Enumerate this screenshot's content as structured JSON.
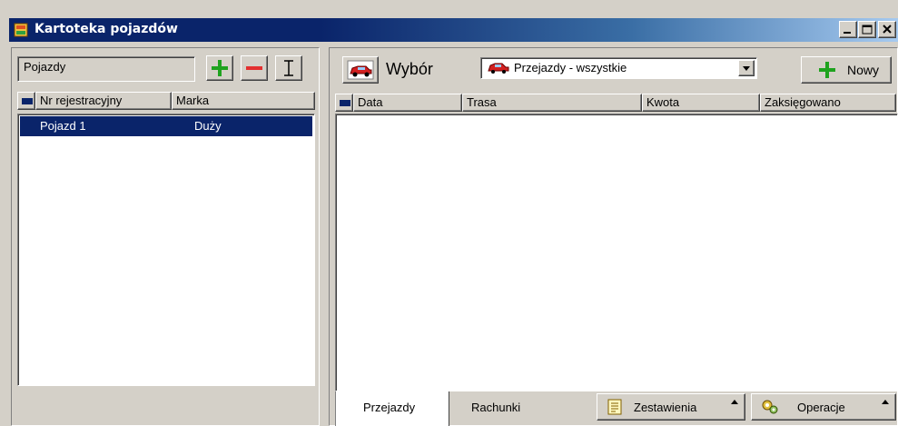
{
  "window": {
    "title": "Kartoteka pojazdów"
  },
  "left": {
    "label": "Pojazdy",
    "columns": [
      "Nr rejestracyjny",
      "Marka"
    ],
    "rows": [
      {
        "nr": "Pojazd 1",
        "marka": "Duży",
        "selected": true
      }
    ]
  },
  "right": {
    "wybor_label": "Wybór",
    "combo_value": "Przejazdy - wszystkie",
    "new_label": "Nowy",
    "columns": [
      "Data",
      "Trasa",
      "Kwota",
      "Zaksięgowano"
    ],
    "tabs": [
      "Przejazdy",
      "Rachunki"
    ],
    "zestawienia_label": "Zestawienia",
    "operacje_label": "Operacje"
  },
  "colors": {
    "titlebar": "#0a246a",
    "selection": "#0a246a",
    "plus": "#1fa31f",
    "minus": "#e33030",
    "car": "#d22020"
  }
}
